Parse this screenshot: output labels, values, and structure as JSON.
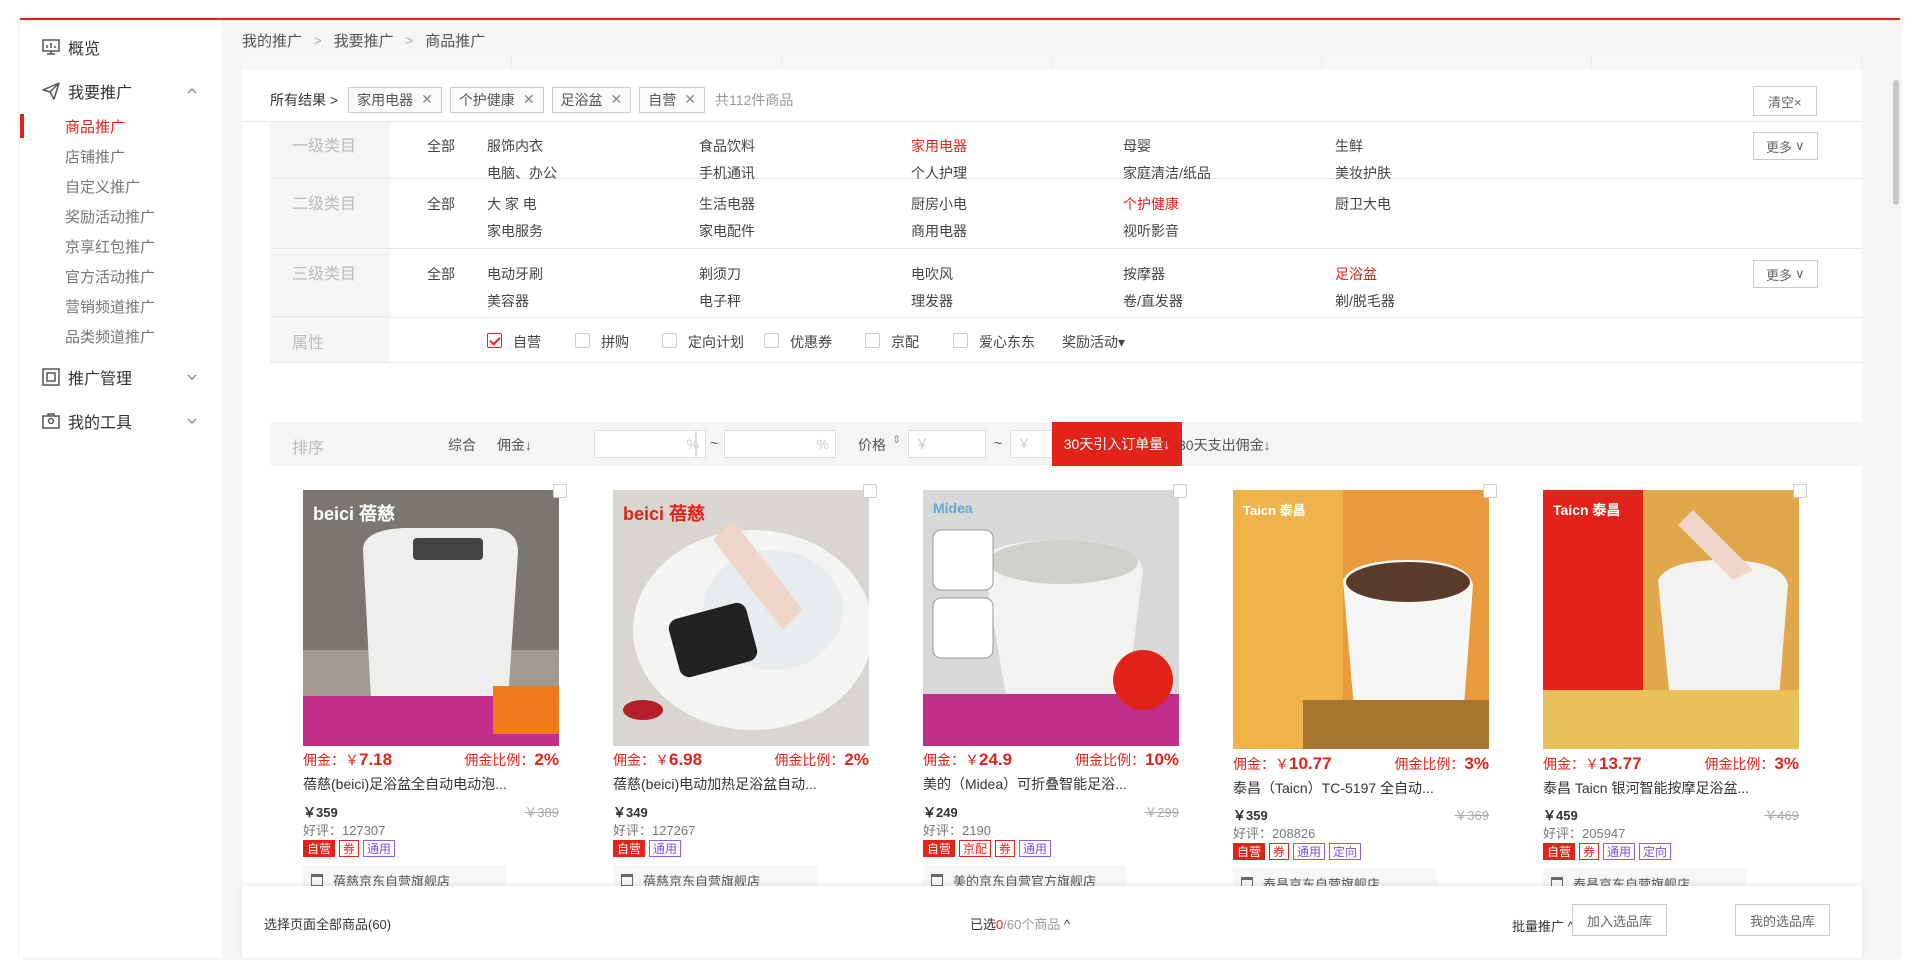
{
  "sidebar": {
    "overview": "概览",
    "promote": "我要推广",
    "sub": [
      "商品推广",
      "店铺推广",
      "自定义推广",
      "奖励活动推广",
      "京享红包推广",
      "官方活动推广",
      "营销频道推广",
      "品类频道推广"
    ],
    "manage": "推广管理",
    "tools": "我的工具"
  },
  "breadcrumb": [
    "我的推广",
    "我要推广",
    "商品推广"
  ],
  "result": {
    "all": "所有结果",
    "chips": [
      "家用电器",
      "个护健康",
      "足浴盆",
      "自营"
    ],
    "count": "共112件商品",
    "clear": "清空×"
  },
  "filters": {
    "all": "全部",
    "more": "更多",
    "level1": {
      "title": "一级类目",
      "options": [
        "服饰内衣",
        "食品饮料",
        "家用电器",
        "母婴",
        "生鲜",
        "电脑、办公",
        "手机通讯",
        "个人护理",
        "家庭清洁/纸品",
        "美妆护肤"
      ]
    },
    "level2": {
      "title": "二级类目",
      "options": [
        "大 家 电",
        "生活电器",
        "厨房小电",
        "个护健康",
        "厨卫大电",
        "家电服务",
        "家电配件",
        "商用电器",
        "视听影音"
      ]
    },
    "level3": {
      "title": "三级类目",
      "options": [
        "电动牙刷",
        "剃须刀",
        "电吹风",
        "按摩器",
        "足浴盆",
        "美容器",
        "电子秤",
        "理发器",
        "卷/直发器",
        "剃/脱毛器"
      ]
    },
    "attr": {
      "title": "属性",
      "options": [
        "自营",
        "拼购",
        "定向计划",
        "优惠券",
        "京配",
        "爱心东东"
      ],
      "reward": "奖励活动"
    }
  },
  "sort": {
    "title": "排序",
    "general": "综合",
    "commission": "佣金↓",
    "pct_placeholder": "%",
    "price": "价格",
    "yen_placeholder": "￥",
    "tilde": "~",
    "active": "30天引入订单量↓",
    "spend": "30天支出佣金↓"
  },
  "cards": [
    {
      "brand": "beici 蓓慈",
      "comm_lbl": "佣金：￥",
      "comm": "7.18",
      "rate_lbl": "佣金比例：",
      "rate": "2%",
      "name": "蓓慈(beici)足浴盆全自动电动泡...",
      "price": "￥359",
      "oprice": "￥389",
      "good": "好评：127307",
      "tags": [
        "自营",
        "券",
        "通用"
      ],
      "shop": "蓓慈京东自营旗舰店"
    },
    {
      "brand": "beici 蓓慈",
      "comm_lbl": "佣金：￥",
      "comm": "6.98",
      "rate_lbl": "佣金比例：",
      "rate": "2%",
      "name": "蓓慈(beici)电动加热足浴盆自动...",
      "price": "￥349",
      "oprice": "",
      "good": "好评：127267",
      "tags": [
        "自营",
        "通用"
      ],
      "shop": "蓓慈京东自营旗舰店"
    },
    {
      "brand": "Midea",
      "comm_lbl": "佣金：￥",
      "comm": "24.9",
      "rate_lbl": "佣金比例：",
      "rate": "10%",
      "name": "美的（Midea）可折叠智能足浴...",
      "price": "￥249",
      "oprice": "￥299",
      "good": "好评：2190",
      "tags": [
        "自营",
        "京配",
        "券",
        "通用"
      ],
      "shop": "美的京东自营官方旗舰店"
    },
    {
      "brand": "Taicn 泰昌",
      "comm_lbl": "佣金：￥",
      "comm": "10.77",
      "rate_lbl": "佣金比例：",
      "rate": "3%",
      "name": "泰昌（Taicn）TC-5197 全自动...",
      "price": "￥359",
      "oprice": "￥369",
      "good": "好评：208826",
      "tags": [
        "自营",
        "券",
        "通用",
        "定向"
      ],
      "shop": "泰昌京东自营旗舰店"
    },
    {
      "brand": "Taicn 泰昌",
      "comm_lbl": "佣金：￥",
      "comm": "13.77",
      "rate_lbl": "佣金比例：",
      "rate": "3%",
      "name": "泰昌 Taicn 银河智能按摩足浴盆...",
      "price": "￥459",
      "oprice": "￥469",
      "good": "好评：205947",
      "tags": [
        "自营",
        "券",
        "通用",
        "定向"
      ],
      "shop": "泰昌京东自营旗舰店"
    }
  ],
  "bottom": {
    "select_all": "选择页面全部商品(60)",
    "selected_pre": "已选",
    "selected_num": "0",
    "selected_total": "/60",
    "selected_post": "个商品",
    "batch": "批量推广",
    "add_lib": "加入选品库",
    "my_lib": "我的选品库"
  },
  "colors": {
    "accent": "#e2231a",
    "tag_purple": "#7b4fe0"
  }
}
